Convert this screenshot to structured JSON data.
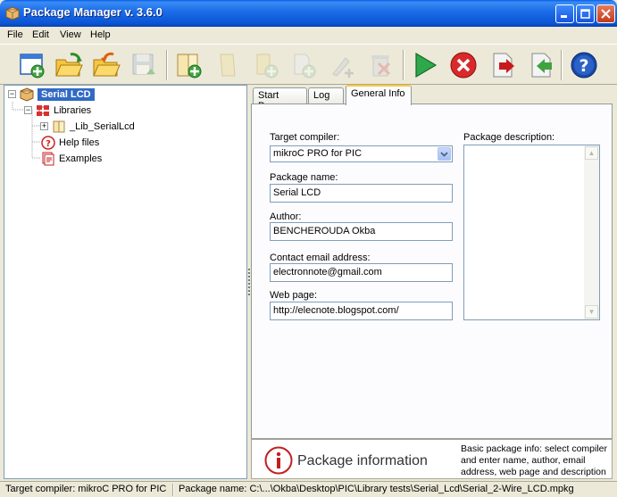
{
  "window": {
    "title": "Package Manager v. 3.6.0"
  },
  "menu": {
    "items": [
      {
        "label": "File"
      },
      {
        "label": "Edit"
      },
      {
        "label": "View"
      },
      {
        "label": "Help"
      }
    ]
  },
  "toolbar": {
    "buttons": [
      {
        "icon": "new-package-icon"
      },
      {
        "icon": "open-folder-icon"
      },
      {
        "icon": "reopen-folder-icon"
      },
      {
        "icon": "save-icon"
      },
      {
        "icon": "add-library-icon"
      },
      {
        "icon": "library-book-icon"
      },
      {
        "icon": "add-help-file-icon"
      },
      {
        "icon": "add-example-icon"
      },
      {
        "icon": "add-item-icon"
      },
      {
        "icon": "delete-icon"
      },
      {
        "icon": "run-icon"
      },
      {
        "icon": "stop-icon"
      },
      {
        "icon": "export-icon"
      },
      {
        "icon": "import-icon"
      },
      {
        "icon": "help-icon"
      }
    ]
  },
  "tree": {
    "root": "Serial LCD",
    "libraries": "Libraries",
    "library_item": "_Lib_SerialLcd",
    "help_files": "Help files",
    "examples": "Examples"
  },
  "tabs": [
    {
      "label": "Start Page"
    },
    {
      "label": "Log"
    },
    {
      "label": "General Info"
    }
  ],
  "general_info": {
    "target_compiler_label": "Target compiler:",
    "target_compiler_value": "mikroC PRO for PIC",
    "package_name_label": "Package name:",
    "package_name_value": "Serial LCD",
    "author_label": "Author:",
    "author_value": "BENCHEROUDA Okba",
    "email_label": "Contact email address:",
    "email_value": "electronnote@gmail.com",
    "web_label": "Web page:",
    "web_value": "http://elecnote.blogspot.com/",
    "description_label": "Package description:"
  },
  "info_banner": {
    "title": "Package information",
    "description": "Basic package info: select compiler and enter name, author, email address, web page and description"
  },
  "status": {
    "compiler": "Target compiler: mikroC PRO for PIC",
    "package_name": "Package name: C:\\...\\Okba\\Desktop\\PIC\\Library tests\\Serial_Lcd\\Serial_2-Wire_LCD.mpkg"
  },
  "colors": {
    "title_bar": "#1d6ee8",
    "selection": "#316ac5",
    "tab_highlight": "#ffc83c"
  }
}
